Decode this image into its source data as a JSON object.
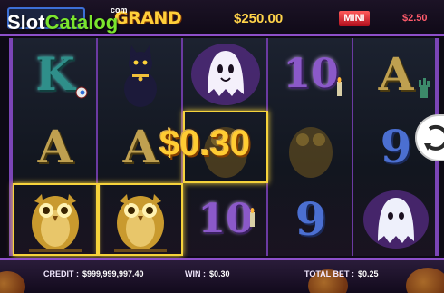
{
  "watermark": {
    "part1": "Slot",
    "part2": "Catalog",
    "suffix": "com"
  },
  "jackpots": {
    "grand_label": "GRAND",
    "grand_value": "$250.00",
    "mini_label": "MINI",
    "mini_value": "$2.50"
  },
  "reels": {
    "win_amount": "$0.30",
    "symbols": [
      [
        "K",
        "A",
        "owl"
      ],
      [
        "cat",
        "A",
        "owl"
      ],
      [
        "ghost",
        "owl",
        "10"
      ],
      [
        "10",
        "owl",
        "9"
      ],
      [
        "A",
        "9",
        "ghost"
      ]
    ]
  },
  "status": {
    "credit_label": "CREDIT :",
    "credit_value": "$999,999,997.40",
    "win_label": "WIN :",
    "win_value": "$0.30",
    "total_bet_label": "TOTAL BET :",
    "total_bet_value": "$0.25"
  },
  "colors": {
    "frame": "#7b45b6",
    "win_gold": "#ffcc33",
    "grand_gold": "#ffcf3a",
    "mini_red": "#ff5b6c"
  }
}
